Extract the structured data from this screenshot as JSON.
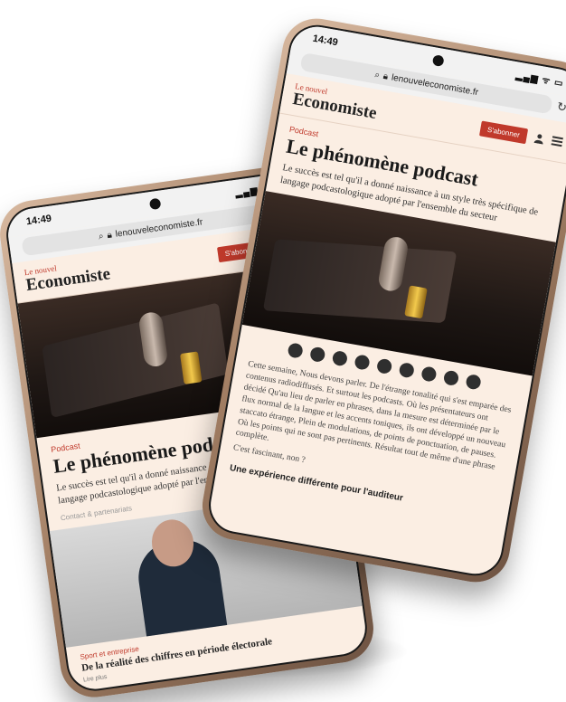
{
  "left_phone": {
    "time": "14:49",
    "url": "lenouveleconomiste.fr",
    "logo_top": "Le nouvel",
    "logo_main": "Economiste",
    "subscribe": "S'abonner",
    "kicker": "Podcast",
    "title": "Le phénomène podcast",
    "lead": "Le succès est tel qu'il a donné naissance à un style très spécifique de langage podcastologique adopté par l'ensemble du secteur",
    "meta": "Contact & partenariats",
    "second_kicker": "Sport et entreprise",
    "second_title": "De la réalité des chiffres en période électorale",
    "second_meta": "Lire plus"
  },
  "right_phone": {
    "time": "14:49",
    "url": "lenouveleconomiste.fr",
    "logo_top": "Le nouvel",
    "logo_main": "Economiste",
    "subscribe": "S'abonner",
    "kicker": "Podcast",
    "title": "Le phénomène podcast",
    "lead": "Le succès est tel qu'il a donné naissance à un style très spécifique de langage podcastologique adopté par l'ensemble du secteur",
    "body1": "Cette semaine, Nous devons parler. De l'étrange tonalité qui s'est emparée des contenus radiodiffusés. Et surtout les podcasts. Où les présentateurs ont décidé Qu'au lieu de parler en phrases, dans la mesure est déterminée par le flux normal de la langue et les accents toniques, ils ont développé un nouveau staccato étrange, Plein de modulations, de points de ponctuation, de pauses. Où les points qui ne sont pas pertinents. Résultat tout de même d'une phrase complète.",
    "body2": "C'est fascinant, non ?",
    "subhead": "Une expérience différente pour l'auditeur"
  },
  "colors": {
    "brand_red": "#c0392b",
    "page_bg": "#fbeee3"
  }
}
